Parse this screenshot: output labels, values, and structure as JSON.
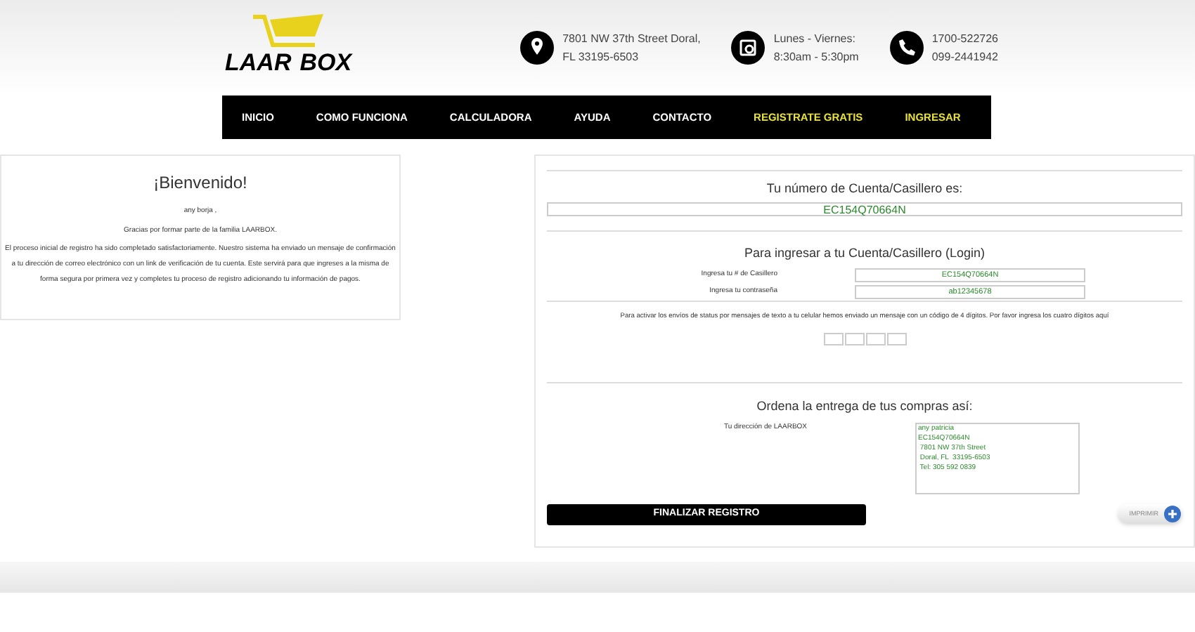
{
  "logo": {
    "part_1": "LAAR",
    "part_2": "BOX"
  },
  "contact": [
    {
      "kind": "location",
      "lines": [
        "7801 NW 37th Street Doral,",
        "FL 33195-6503"
      ]
    },
    {
      "kind": "hours",
      "lines": [
        "Lunes - Viernes:",
        "8:30am - 5:30pm"
      ]
    },
    {
      "kind": "phone",
      "lines": [
        "1700-522726",
        "099-2441942"
      ]
    }
  ],
  "nav": [
    {
      "label": "INICIO",
      "highlighted": false
    },
    {
      "label": "COMO FUNCIONA",
      "highlighted": false
    },
    {
      "label": "CALCULADORA",
      "highlighted": false
    },
    {
      "label": "AYUDA",
      "highlighted": false
    },
    {
      "label": "CONTACTO",
      "highlighted": false
    },
    {
      "label": "REGISTRATE GRATIS",
      "highlighted": true
    },
    {
      "label": "INGRESAR",
      "highlighted": true
    }
  ],
  "welcome": {
    "title": "¡Bienvenido!",
    "name": "any borja ,",
    "thanks": "Gracias por formar parte de la familia LAARBOX.",
    "body": "El proceso inicial de registro ha sido completado satisfactoriamente. Nuestro sistema ha enviado un mensaje de confirmación a tu dirección de correo electrónico con un link de verificación de tu cuenta. Este servirá para que ingreses a la misma de forma segura por primera vez y completes tu proceso de registro adicionando tu información de pagos."
  },
  "account": {
    "title": "Tu número de Cuenta/Casillero es:",
    "value": "EC154Q70664N"
  },
  "login": {
    "title": "Para ingresar a tu Cuenta/Casillero (Login)",
    "fields": [
      {
        "label": "Ingresa tu # de Casillero",
        "value": "EC154Q70664N"
      },
      {
        "label": "Ingresa tu contraseña",
        "value": "ab12345678"
      }
    ],
    "sms_note": "Para activar los envíos de status por mensajes de texto a tu celular hemos enviado un mensaje con un código de 4 dígitos. Por favor ingresa los cuatro dígitos aquí"
  },
  "delivery": {
    "title": "Ordena la entrega de tus compras así:",
    "label": "Tu dirección de LAARBOX",
    "address": "any patricia\nEC154Q70664N\n 7801 NW 37th Street\n Doral, FL  33195-6503\n Tel: 305 592 0839"
  },
  "buttons": {
    "finish": "FINALIZAR REGISTRO",
    "print": "IMPRIMIR"
  }
}
